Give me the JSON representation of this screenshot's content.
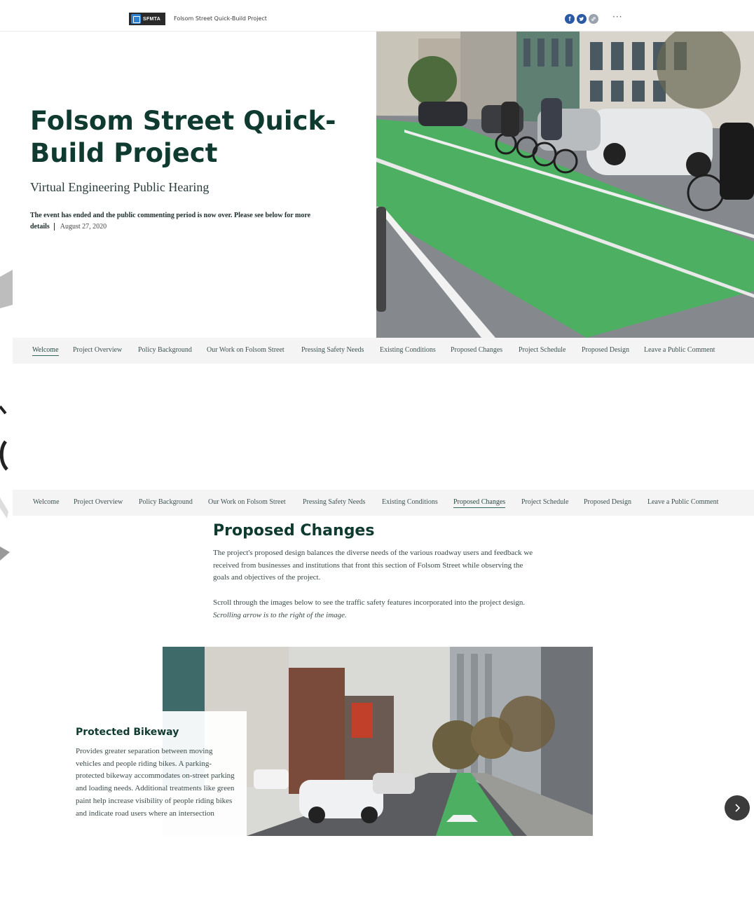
{
  "header": {
    "logo_text": "SFMTA",
    "site_title": "Folsom Street Quick-Build Project",
    "share_icons": [
      "facebook-icon",
      "twitter-icon",
      "link-icon"
    ],
    "more_label": "···"
  },
  "hero": {
    "title": "Folsom Street Quick-Build Project",
    "subtitle": "Virtual Engineering Public Hearing",
    "description": "The event has ended and the public commenting period is now over. Please see below for more details",
    "date": "August 27, 2020",
    "image_alt": "People riding bikes in a green protected bike lane next to traffic"
  },
  "nav": {
    "items": [
      "Welcome",
      "Project Overview",
      "Policy Background",
      "Our Work on Folsom Street",
      "Pressing Safety Needs",
      "Existing Conditions",
      "Proposed Changes",
      "Project Schedule",
      "Proposed Design",
      "Leave a Public Comment"
    ],
    "top_active": "Welcome",
    "bottom_active": "Proposed Changes"
  },
  "proposed_changes": {
    "title": "Proposed Changes",
    "paragraph1": "The project's proposed design balances the diverse needs of the various roadway users and feedback we received from businesses and institutions that front this section of Folsom Street while observing the goals and objectives of the project.",
    "paragraph2": "Scroll through the images below to see the traffic safety features incorporated into the project design.",
    "paragraph2_italic": "Scrolling arrow is to the right of the image.",
    "slide": {
      "title": "Protected Bikeway",
      "text": "Provides greater separation between moving vehicles and people riding bikes. A parking-protected bikeway accommodates on-street parking and loading needs. Additional treatments like green paint help increase visibility of people riding bikes and indicate road users where an intersection",
      "image_alt": "Street with parked cars and a green parking-protected bike lane"
    },
    "next_label": "Next"
  },
  "colors": {
    "title": "#0f3a2f",
    "accent": "#2f6b5e",
    "bike_lane": "#4caf62",
    "nav_bg": "#f4f4f4"
  }
}
